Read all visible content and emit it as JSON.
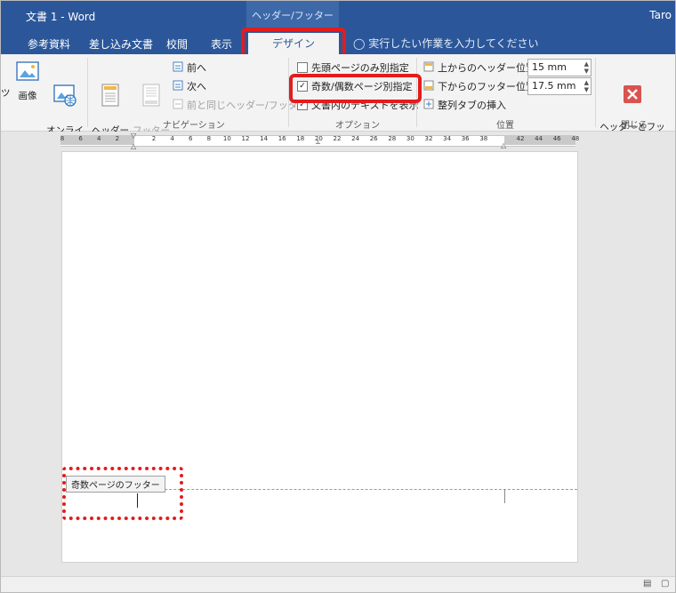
{
  "window": {
    "title": "文書 1 - Word",
    "context_tab_group": "ヘッダー/フッター ツール",
    "user": "Taro"
  },
  "tabs": [
    {
      "label": "参考資料"
    },
    {
      "label": "差し込み文書"
    },
    {
      "label": "校閲"
    },
    {
      "label": "表示"
    },
    {
      "label": "デザイン"
    }
  ],
  "tell_me": {
    "placeholder": "実行したい作業を入力してください",
    "icon": "lightbulb-icon"
  },
  "ribbon": {
    "insert_group": {
      "partial_label": "ツ",
      "image_label": "画像",
      "online_image_label": "オンライン\n画像"
    },
    "navigation": {
      "goto_header_label": "ヘッダーに\n移動",
      "goto_footer_label": "フッターに\n移動",
      "prev_label": "前へ",
      "next_label": "次へ",
      "link_prev_label": "前と同じヘッダー/フッター",
      "group_label": "ナビゲーション"
    },
    "options": {
      "first_page_label": "先頭ページのみ別指定",
      "first_page_checked": false,
      "odd_even_label": "奇数/偶数ページ別指定",
      "odd_even_checked": true,
      "show_text_label": "文書内のテキストを表示",
      "show_text_checked": true,
      "group_label": "オプション"
    },
    "position": {
      "header_pos_label": "上からのヘッダー位置:",
      "header_pos_value": "15 mm",
      "footer_pos_label": "下からのフッター位置:",
      "footer_pos_value": "17.5 mm",
      "align_tab_label": "整列タブの挿入",
      "group_label": "位置"
    },
    "close": {
      "close_label": "ヘッダーとフッター\nを閉じる",
      "group_label": "閉じる"
    }
  },
  "ruler": {
    "ticks": [
      "8",
      "6",
      "4",
      "2",
      "",
      "2",
      "4",
      "6",
      "8",
      "10",
      "12",
      "14",
      "16",
      "18",
      "20",
      "22",
      "24",
      "26",
      "28",
      "30",
      "32",
      "34",
      "36",
      "38",
      "",
      "42",
      "44",
      "46",
      "48"
    ]
  },
  "document": {
    "footer_tag": "奇数ページのフッター"
  },
  "colors": {
    "brand": "#2b579a",
    "highlight": "#e31c1c",
    "close_icon": "#d9534f"
  }
}
